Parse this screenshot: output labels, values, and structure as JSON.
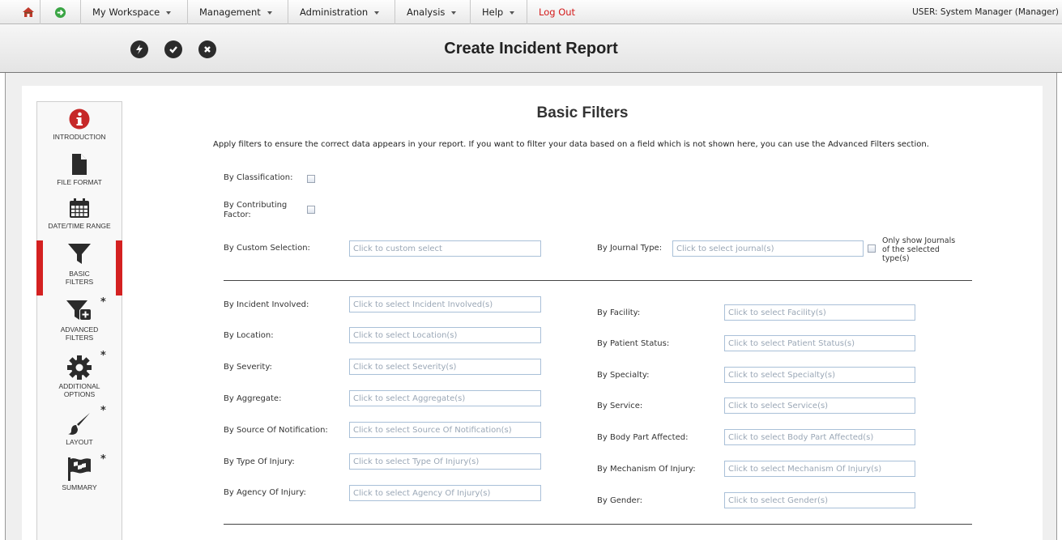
{
  "menubar": {
    "items": [
      {
        "label": "My Workspace"
      },
      {
        "label": "Management"
      },
      {
        "label": "Administration"
      },
      {
        "label": "Analysis"
      },
      {
        "label": "Help"
      }
    ],
    "logout_label": "Log Out",
    "user_label": "USER: System Manager (Manager)",
    "home_icon": "home-icon",
    "forward_icon": "arrow-right-circle-icon"
  },
  "toolbar": {
    "title": "Create Incident Report",
    "buttons": [
      "lightning-icon",
      "check-circle-icon",
      "close-circle-icon"
    ]
  },
  "wizard": {
    "steps": [
      {
        "label": "INTRODUCTION",
        "icon": "info-icon",
        "required": false
      },
      {
        "label": "FILE FORMAT",
        "icon": "file-icon",
        "required": false
      },
      {
        "label": "DATE/TIME RANGE",
        "icon": "calendar-icon",
        "required": false
      },
      {
        "label_line1": "BASIC",
        "label_line2": "FILTERS",
        "icon": "filter-icon",
        "active": true
      },
      {
        "label_line1": "ADVANCED",
        "label_line2": "FILTERS",
        "icon": "filter-plus-icon",
        "required": true
      },
      {
        "label_line1": "ADDITIONAL",
        "label_line2": "OPTIONS",
        "icon": "gear-icon",
        "required": true
      },
      {
        "label": "LAYOUT",
        "icon": "brush-icon",
        "required": true
      },
      {
        "label": "SUMMARY",
        "icon": "flag-icon",
        "required": true
      }
    ],
    "star": "*"
  },
  "main": {
    "heading": "Basic Filters",
    "intro": "Apply filters to ensure the correct data appears in your report. If you want to filter your data based on a field which is not shown here, you can use the Advanced Filters section.",
    "classification_label": "By Classification:",
    "contributing_label_1": "By Contributing",
    "contributing_label_2": "Factor:",
    "custom_label": "By Custom Selection:",
    "custom_placeholder": "Click to custom select",
    "journal_label": "By Journal Type:",
    "journal_placeholder": "Click to select journal(s)",
    "journal_only_1": "Only show Journals",
    "journal_only_2": "of the selected",
    "journal_only_3": "type(s)",
    "left_filters": [
      {
        "label": "By Incident Involved:",
        "placeholder": "Click to select Incident Involved(s)"
      },
      {
        "label": "By Location:",
        "placeholder": "Click to select Location(s)"
      },
      {
        "label": "By Severity:",
        "placeholder": "Click to select Severity(s)"
      },
      {
        "label": "By Aggregate:",
        "placeholder": "Click to select Aggregate(s)"
      },
      {
        "label": "By Source Of Notification:",
        "placeholder": "Click to select Source Of Notification(s)"
      },
      {
        "label": "By Type Of Injury:",
        "placeholder": "Click to select Type Of Injury(s)"
      },
      {
        "label": "By Agency Of Injury:",
        "placeholder": "Click to select Agency Of Injury(s)"
      }
    ],
    "right_filters": [
      {
        "label": "By Facility:",
        "placeholder": "Click to select Facility(s)"
      },
      {
        "label": "By Patient Status:",
        "placeholder": "Click to select Patient Status(s)"
      },
      {
        "label": "By Specialty:",
        "placeholder": "Click to select Specialty(s)"
      },
      {
        "label": "By Service:",
        "placeholder": "Click to select Service(s)"
      },
      {
        "label": "By Body Part Affected:",
        "placeholder": "Click to select Body Part Affected(s)"
      },
      {
        "label": "By Mechanism Of Injury:",
        "placeholder": "Click to select Mechanism Of Injury(s)"
      },
      {
        "label": "By Gender:",
        "placeholder": "Click to select Gender(s)"
      }
    ]
  },
  "colors": {
    "accent": "#d42121",
    "logout": "#d31a1a",
    "field_border": "#a9c0d8"
  }
}
